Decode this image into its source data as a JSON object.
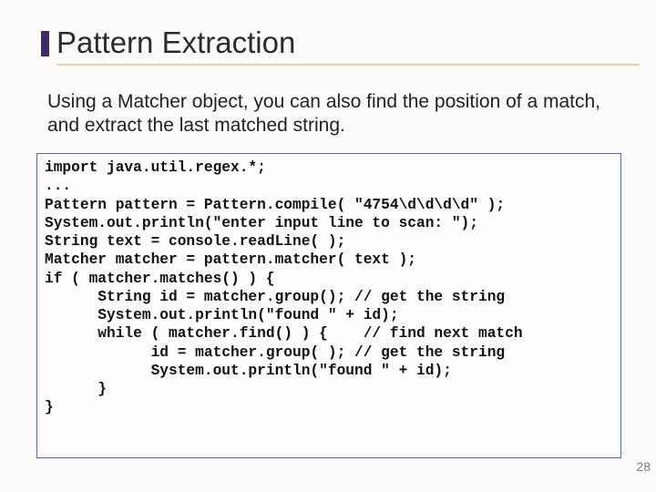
{
  "title": "Pattern Extraction",
  "body": "Using a Matcher object, you can also find the position of a match, and extract the last matched string.",
  "code": "import java.util.regex.*;\n...\nPattern pattern = Pattern.compile( \"4754\\d\\d\\d\\d\" );\nSystem.out.println(\"enter input line to scan: \");\nString text = console.readLine( );\nMatcher matcher = pattern.matcher( text );\nif ( matcher.matches() ) {\n      String id = matcher.group(); // get the string\n      System.out.println(\"found \" + id);\n      while ( matcher.find() ) {    // find next match\n            id = matcher.group( ); // get the string\n            System.out.println(\"found \" + id);\n      }\n}",
  "page_number": "28"
}
